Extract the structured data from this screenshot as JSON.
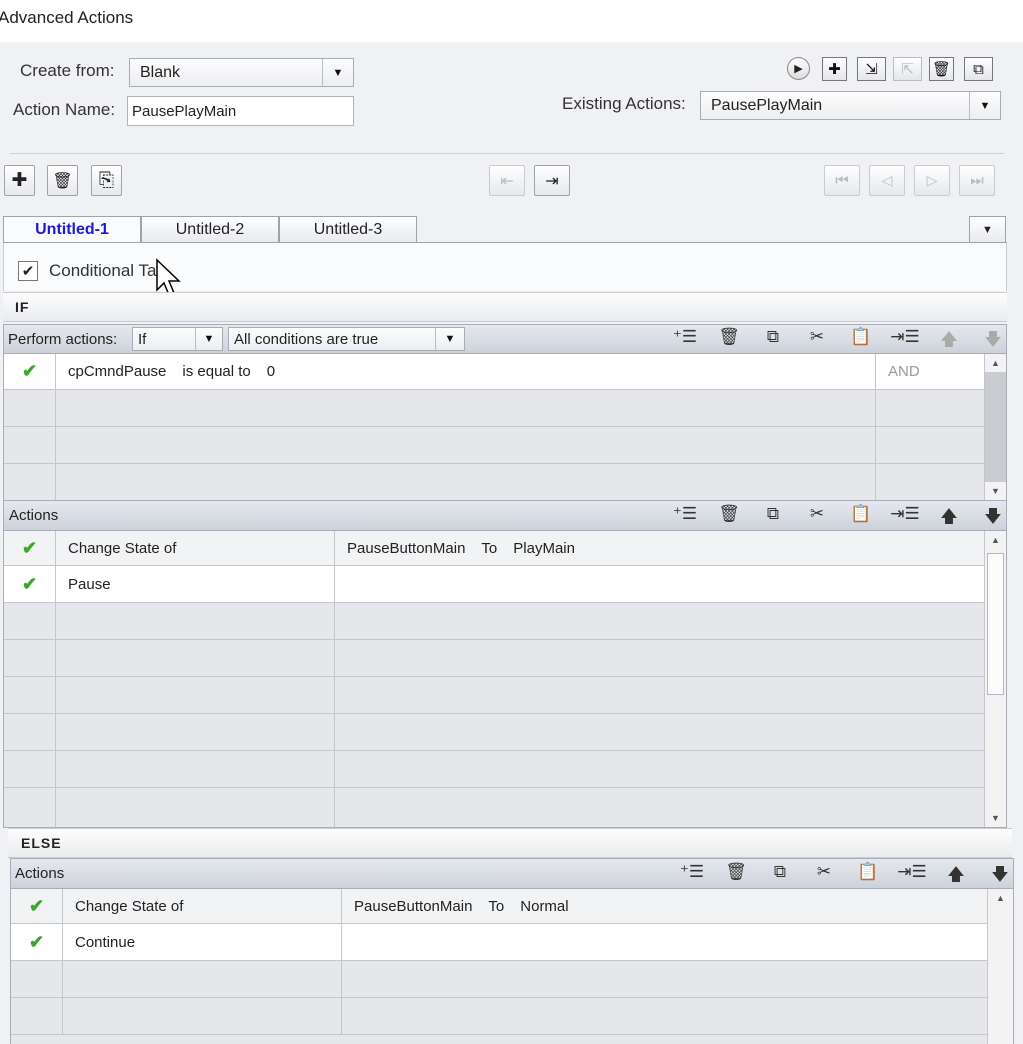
{
  "window": {
    "title": "Advanced Actions"
  },
  "header": {
    "create_from_label": "Create from:",
    "create_from_value": "Blank",
    "action_name_label": "Action Name:",
    "action_name_value": "PausePlayMain",
    "existing_actions_label": "Existing Actions:",
    "existing_actions_value": "PausePlayMain"
  },
  "tabs": [
    {
      "label": "Untitled-1",
      "active": true
    },
    {
      "label": "Untitled-2",
      "active": false
    },
    {
      "label": "Untitled-3",
      "active": false
    }
  ],
  "conditional": {
    "label": "Conditional Tab",
    "checked": true
  },
  "if_section": {
    "title": "IF",
    "perform_label": "Perform actions:",
    "perform_value": "If",
    "conditions_value": "All conditions are true",
    "rows": [
      {
        "variable": "cpCmndPause",
        "operator": "is equal to",
        "value": "0",
        "logic": "AND"
      }
    ]
  },
  "if_actions": {
    "title": "Actions",
    "rows": [
      {
        "action": "Change State of",
        "object": "PauseButtonMain",
        "to": "To",
        "state": "PlayMain"
      },
      {
        "action": "Pause",
        "object": "",
        "to": "",
        "state": ""
      }
    ]
  },
  "else_section": {
    "title": "ELSE"
  },
  "else_actions": {
    "title": "Actions",
    "rows": [
      {
        "action": "Change State of",
        "object": "PauseButtonMain",
        "to": "To",
        "state": "Normal"
      },
      {
        "action": "Continue",
        "object": "",
        "to": "",
        "state": ""
      }
    ]
  },
  "colors": {
    "active_tab": "#1d1ad0",
    "check": "#3aa72a",
    "panel_bg": "#f0f1f4"
  }
}
